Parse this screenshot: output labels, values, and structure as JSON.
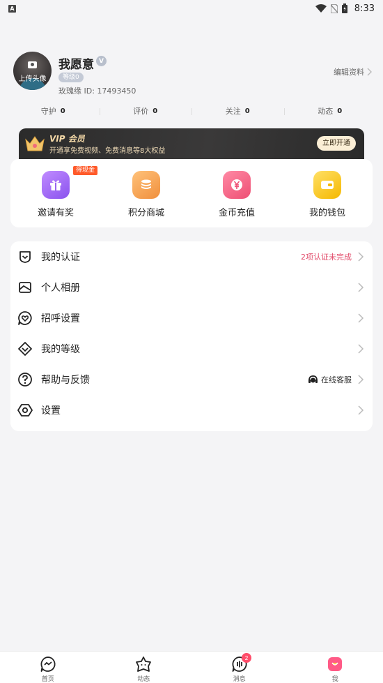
{
  "status_bar": {
    "time": "8:33",
    "app_indicator": "A"
  },
  "profile": {
    "avatar_label": "上传头像",
    "nickname": "我愿意",
    "verified_mark": "V",
    "level": "等级0",
    "id_text": "玫瑰缘 ID: 17493450",
    "edit_label": "编辑资料"
  },
  "stats": [
    {
      "label": "守护",
      "value": "0"
    },
    {
      "label": "评价",
      "value": "0"
    },
    {
      "label": "关注",
      "value": "0"
    },
    {
      "label": "动态",
      "value": "0"
    }
  ],
  "vip": {
    "title": "VIP 会员",
    "subtitle": "开通享免费视频、免费消息等8大权益",
    "button": "立即开通"
  },
  "quick_actions": [
    {
      "label": "邀请有奖",
      "badge": "得现金",
      "icon": "gift-icon",
      "color": "#a66bf2"
    },
    {
      "label": "积分商城",
      "icon": "coins-icon",
      "color": "#f4a24a"
    },
    {
      "label": "金币充值",
      "icon": "yuan-coin-icon",
      "color": "#f25a7e"
    },
    {
      "label": "我的钱包",
      "icon": "wallet-icon",
      "color": "#f7c830"
    }
  ],
  "menu": [
    {
      "label": "我的认证",
      "extra": "2项认证未完成",
      "icon": "shield-check-icon"
    },
    {
      "label": "个人相册",
      "icon": "album-icon"
    },
    {
      "label": "招呼设置",
      "icon": "heart-chat-icon"
    },
    {
      "label": "我的等级",
      "icon": "diamond-icon"
    },
    {
      "label": "帮助与反馈",
      "extra": "在线客服",
      "icon": "question-icon"
    },
    {
      "label": "设置",
      "icon": "hexagon-settings-icon"
    }
  ],
  "tabs": [
    {
      "label": "首页",
      "icon": "home-heart-icon"
    },
    {
      "label": "动态",
      "icon": "star-face-icon"
    },
    {
      "label": "消息",
      "icon": "message-icon",
      "badge": "2"
    },
    {
      "label": "我",
      "icon": "me-icon",
      "active": true
    }
  ],
  "colors": {
    "accent_pink": "#ff4d6a",
    "text_red": "#e24b6a",
    "vip_gold": "#f4d9a8"
  }
}
